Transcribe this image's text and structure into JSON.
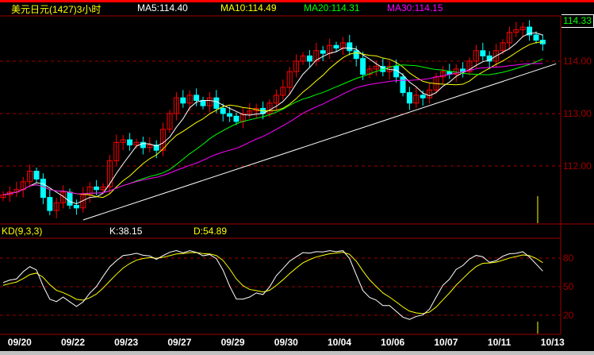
{
  "header": {
    "title": "美元日元(1427)3小时",
    "ma5": "MA5:114.40",
    "ma10": "MA10:114.49",
    "ma20": "MA20:114.31",
    "ma30": "MA30:114.15"
  },
  "kd_header": {
    "label": "KD(9,3,3)",
    "k": "K:38.15",
    "d": "D:54.89"
  },
  "current_price": "114.33",
  "colors": {
    "up": "#ff0000",
    "down": "#00ffff",
    "ma5": "#ffffff",
    "ma10": "#ffff00",
    "ma20": "#00ff00",
    "ma30": "#ff00ff",
    "axis": "#a00000",
    "k": "#ffffff",
    "d": "#ffff00"
  },
  "chart_data": [
    {
      "type": "candlestick",
      "series": [
        {
          "name": "美元日元",
          "closes": [
            111.45,
            111.5,
            111.55,
            111.7,
            111.9,
            111.75,
            111.4,
            111.15,
            111.3,
            111.5,
            111.25,
            111.2,
            111.45,
            111.6,
            111.55,
            111.6,
            112.1,
            112.45,
            112.5,
            112.4,
            112.45,
            112.35,
            112.4,
            112.3,
            112.7,
            113.0,
            113.3,
            113.2,
            113.35,
            113.25,
            113.15,
            113.3,
            113.1,
            113.0,
            112.95,
            112.85,
            113.0,
            113.05,
            113.1,
            113.0,
            113.2,
            113.35,
            113.5,
            113.8,
            114.0,
            114.1,
            114.0,
            114.2,
            114.15,
            114.3,
            114.25,
            114.35,
            114.2,
            114.05,
            113.75,
            113.85,
            113.9,
            113.8,
            113.9,
            113.7,
            113.4,
            113.2,
            113.35,
            113.3,
            113.45,
            113.7,
            113.8,
            113.75,
            113.85,
            113.8,
            114.0,
            114.2,
            114.1,
            114.0,
            114.2,
            114.35,
            114.55,
            114.6,
            114.65,
            114.5,
            114.4,
            114.33
          ]
        }
      ],
      "moving_averages": [
        5,
        10,
        20,
        30
      ],
      "y_ticks": [
        "114.00",
        "113.00",
        "112.00"
      ],
      "y_tick_values": [
        114,
        113,
        112
      ],
      "ylim": [
        110.8,
        114.9
      ],
      "trendline": [
        [
          12,
          110.97
        ],
        [
          83,
          113.95
        ]
      ],
      "x_ticks": [
        {
          "index": 2,
          "label": "09/20"
        },
        {
          "index": 10,
          "label": "09/22"
        },
        {
          "index": 18,
          "label": "09/23"
        },
        {
          "index": 26,
          "label": "09/27"
        },
        {
          "index": 34,
          "label": "09/29"
        },
        {
          "index": 42,
          "label": "09/30"
        },
        {
          "index": 50,
          "label": "10/04"
        },
        {
          "index": 58,
          "label": "10/06"
        },
        {
          "index": 66,
          "label": "10/07"
        },
        {
          "index": 74,
          "label": "10/11"
        },
        {
          "index": 82,
          "label": "10/13"
        }
      ]
    },
    {
      "type": "line",
      "indicator": "KD(9,3,3)",
      "y_ticks": [
        "80",
        "50",
        "20"
      ],
      "y_tick_values": [
        80,
        50,
        20
      ],
      "ylim": [
        0,
        100
      ]
    }
  ]
}
